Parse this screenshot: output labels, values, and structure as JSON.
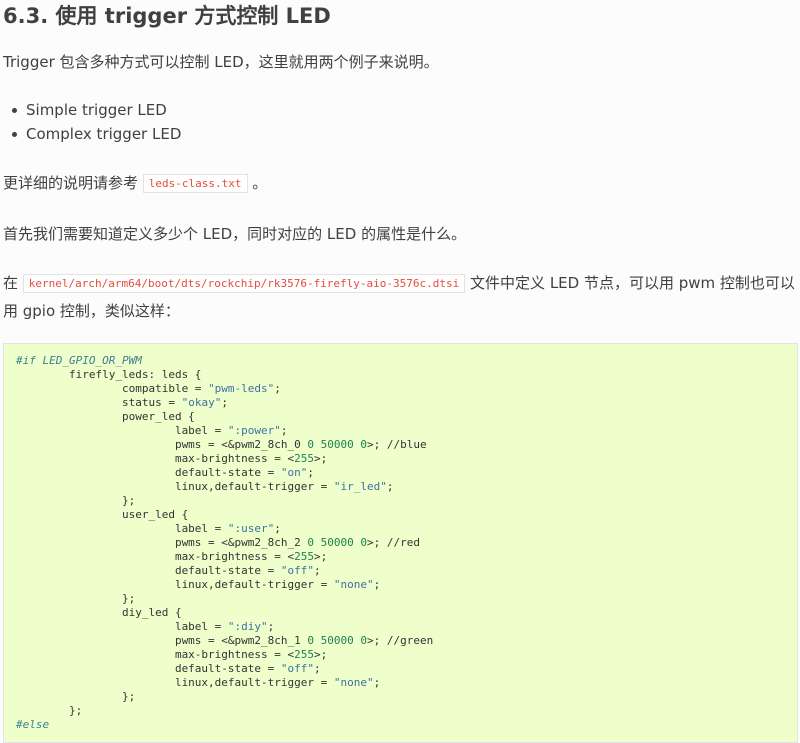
{
  "heading": "6.3. 使用 trigger 方式控制 LED",
  "intro": "Trigger 包含多种方式可以控制 LED，这里就用两个例子来说明。",
  "examples": [
    "Simple trigger LED",
    "Complex trigger LED"
  ],
  "reference": {
    "before": "更详细的说明请参考",
    "file": "leds-class.txt",
    "after": "。"
  },
  "question": "首先我们需要知道定义多少个 LED，同时对应的 LED 的属性是什么。",
  "dts_note": {
    "before": "在",
    "file": "kernel/arch/arm64/boot/dts/rockchip/rk3576-firefly-aio-3576c.dtsi",
    "after": "文件中定义 LED 节点，可以用 pwm 控制也可以用 gpio 控制，类似这样："
  },
  "code": {
    "line1": "#if LED_GPIO_OR_PWM",
    "line2": "        firefly_leds: leds {",
    "compatible_key": "                compatible = ",
    "compatible_val": "\"pwm-leds\"",
    "status_key": "                status = ",
    "status_val": "\"okay\"",
    "leds": [
      {
        "open": "                power_led {",
        "label_val": "\":power\"",
        "pwms_a": "                        pwms = <&pwm2_8ch_0 ",
        "pwms_n1": "0",
        "pwms_n2": "50000",
        "pwms_n3": "0",
        "pwms_tail": ">; //blue",
        "brightness": "255",
        "state": "\"on\"",
        "trigger": "\"ir_led\""
      },
      {
        "open": "                user_led {",
        "label_val": "\":user\"",
        "pwms_a": "                        pwms = <&pwm2_8ch_2 ",
        "pwms_n1": "0",
        "pwms_n2": "50000",
        "pwms_n3": "0",
        "pwms_tail": ">; //red",
        "brightness": "255",
        "state": "\"off\"",
        "trigger": "\"none\""
      },
      {
        "open": "                diy_led {",
        "label_val": "\":diy\"",
        "pwms_a": "                        pwms = <&pwm2_8ch_1 ",
        "pwms_n1": "0",
        "pwms_n2": "50000",
        "pwms_n3": "0",
        "pwms_tail": ">; //green",
        "brightness": "255",
        "state": "\"off\"",
        "trigger": "\"none\""
      }
    ],
    "label_key": "                        label = ",
    "brightness_key": "                        max-brightness = <",
    "brightness_tail": ">;",
    "state_key": "                        default-state = ",
    "trigger_key": "                        linux,default-trigger = ",
    "semi": ";",
    "close_inner": "                };",
    "close_outer": "        };",
    "else": "#else"
  },
  "colors": {
    "text": "#404040",
    "code_bg": "#eeffcc",
    "inline_code": "#e74c3c",
    "comment": "#408090",
    "string": "#4070a0",
    "number": "#208050"
  }
}
